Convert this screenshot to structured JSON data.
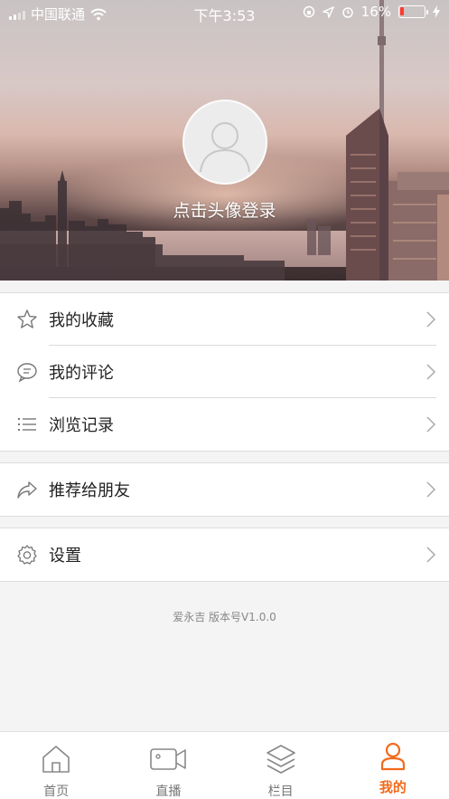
{
  "status_bar": {
    "carrier": "中国联通",
    "time": "下午3:53",
    "battery_percent": "16%",
    "battery_level": 0.16,
    "icons": [
      "signal-icon",
      "wifi-icon",
      "orientation-lock-icon",
      "location-icon",
      "alarm-icon",
      "battery-icon",
      "charging-icon"
    ]
  },
  "profile": {
    "avatar_icon": "user-avatar-icon",
    "login_text": "点击头像登录"
  },
  "menu": {
    "group1": [
      {
        "label": "我的收藏",
        "icon": "star-icon"
      },
      {
        "label": "我的评论",
        "icon": "comment-icon"
      },
      {
        "label": "浏览记录",
        "icon": "list-icon"
      }
    ],
    "group2": [
      {
        "label": "推荐给朋友",
        "icon": "share-icon"
      }
    ],
    "group3": [
      {
        "label": "设置",
        "icon": "gear-icon"
      }
    ]
  },
  "footer": {
    "version_text": "爱永吉  版本号V1.0.0"
  },
  "tabbar": {
    "active_color": "#f26a1b",
    "tabs": [
      {
        "label": "首页",
        "icon": "home-icon"
      },
      {
        "label": "直播",
        "icon": "video-camera-icon"
      },
      {
        "label": "栏目",
        "icon": "layers-icon"
      },
      {
        "label": "我的",
        "icon": "user-icon",
        "active": true
      }
    ]
  }
}
